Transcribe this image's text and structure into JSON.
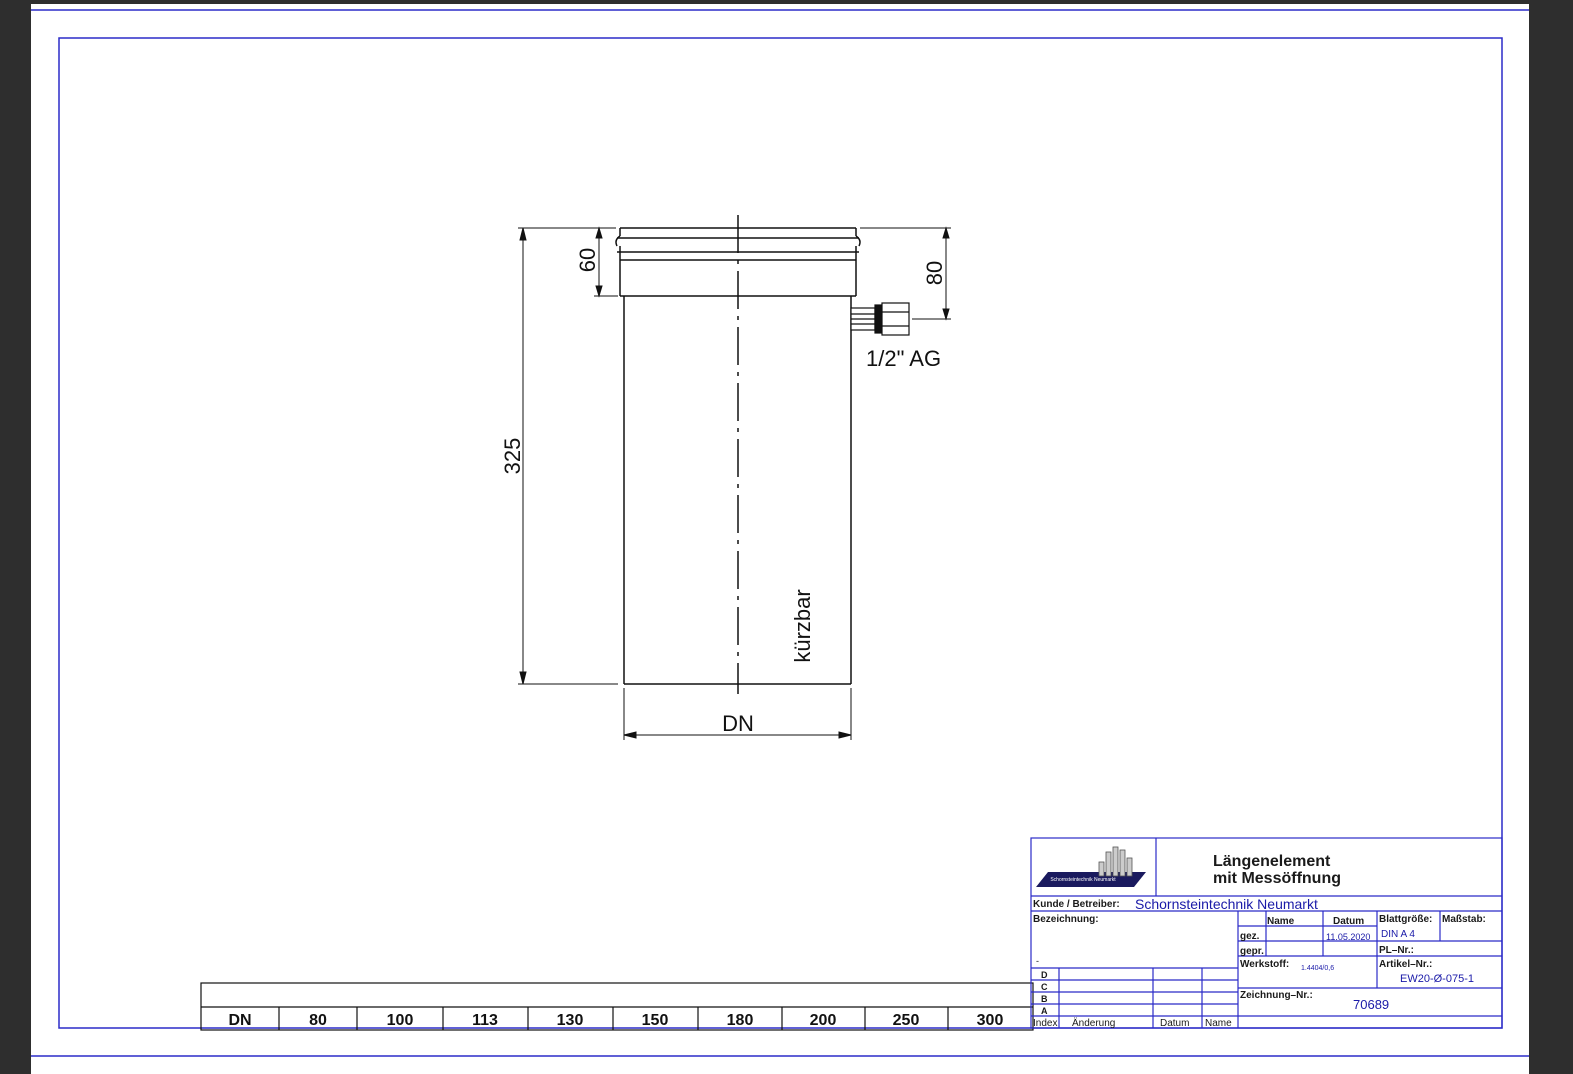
{
  "drawing": {
    "dims": {
      "socket_height": "60",
      "port_offset": "80",
      "total_length": "325",
      "diameter": "DN",
      "port_thread": "1/2\" AG",
      "cuttable_note": "kürzbar"
    }
  },
  "dn_table": {
    "header": "DN",
    "sizes": [
      "80",
      "100",
      "113",
      "130",
      "150",
      "180",
      "200",
      "250",
      "300"
    ]
  },
  "title_block": {
    "logo_text": "Schornsteintechnik Neumarkt",
    "title_line1": "Längenelement",
    "title_line2": "mit Messöffnung",
    "customer_label": "Kunde / Betreiber:",
    "customer_value": "Schornsteintechnik Neumarkt",
    "designation_label": "Bezeichnung:",
    "designation_value": "-",
    "col_name": "Name",
    "col_date": "Datum",
    "drawn_label": "gez.",
    "drawn_date": "11.05.2020",
    "checked_label": "gepr.",
    "sheet_size_label": "Blattgröße:",
    "sheet_size_value": "DIN A 4",
    "scale_label": "Maßstab:",
    "pl_label": "PL–Nr.:",
    "material_label": "Werkstoff:",
    "material_value": "1.4404/0,6",
    "article_label": "Artikel–Nr.:",
    "article_value": "EW20-Ø-075-1",
    "drawing_no_label": "Zeichnung–Nr.:",
    "drawing_no_value": "70689",
    "revisions": [
      "D",
      "C",
      "B",
      "A"
    ],
    "rev_index": "Index",
    "rev_change": "Änderung",
    "rev_date": "Datum",
    "rev_name": "Name"
  },
  "colors": {
    "frame": "#2b2bc8",
    "line": "#111111",
    "background": "#2e2e2e"
  }
}
